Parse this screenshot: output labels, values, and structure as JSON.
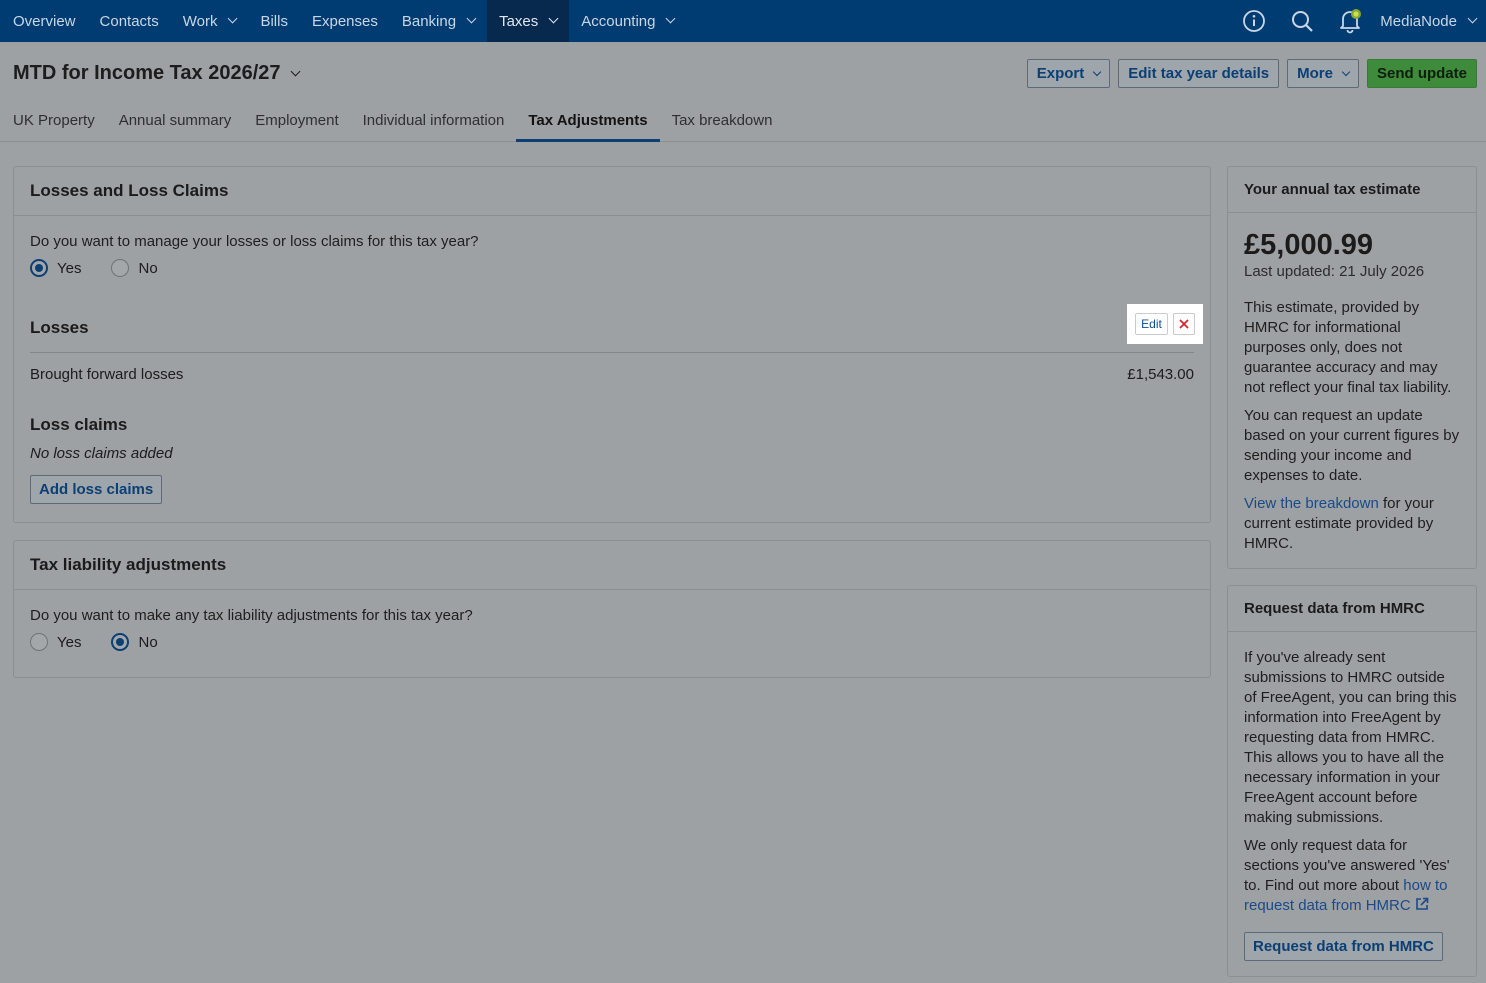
{
  "nav": {
    "items": [
      {
        "label": "Overview",
        "dropdown": false,
        "active": false
      },
      {
        "label": "Contacts",
        "dropdown": false,
        "active": false
      },
      {
        "label": "Work",
        "dropdown": true,
        "active": false
      },
      {
        "label": "Bills",
        "dropdown": false,
        "active": false
      },
      {
        "label": "Expenses",
        "dropdown": false,
        "active": false
      },
      {
        "label": "Banking",
        "dropdown": true,
        "active": false
      },
      {
        "label": "Taxes",
        "dropdown": true,
        "active": true
      },
      {
        "label": "Accounting",
        "dropdown": true,
        "active": false
      }
    ],
    "account": "MediaNode",
    "icons": [
      "info-icon",
      "search-icon",
      "bell-icon"
    ]
  },
  "header": {
    "title": "MTD for Income Tax 2026/27",
    "actions": {
      "export": "Export",
      "edit_tax_year": "Edit tax year details",
      "more": "More",
      "send_update": "Send update"
    },
    "tabs": [
      {
        "label": "UK Property",
        "active": false
      },
      {
        "label": "Annual summary",
        "active": false
      },
      {
        "label": "Employment",
        "active": false
      },
      {
        "label": "Individual information",
        "active": false
      },
      {
        "label": "Tax Adjustments",
        "active": true
      },
      {
        "label": "Tax breakdown",
        "active": false
      }
    ]
  },
  "losses_card": {
    "title": "Losses and Loss Claims",
    "question": "Do you want to manage your losses or loss claims for this tax year?",
    "yes_label": "Yes",
    "no_label": "No",
    "selected": "Yes",
    "losses_title": "Losses",
    "edit_label": "Edit",
    "row_label": "Brought forward losses",
    "row_value": "£1,543.00",
    "claims_title": "Loss claims",
    "claims_empty": "No loss claims added",
    "add_claims": "Add loss claims"
  },
  "liability_card": {
    "title": "Tax liability adjustments",
    "question": "Do you want to make any tax liability adjustments for this tax year?",
    "yes_label": "Yes",
    "no_label": "No",
    "selected": "No"
  },
  "estimate_card": {
    "title": "Your annual tax estimate",
    "amount": "£5,000.99",
    "updated": "Last updated: 21 July 2026",
    "para1": "This estimate, provided by HMRC for informational purposes only, does not guarantee accuracy and may not reflect your final tax liability.",
    "para2": "You can request an update based on your current figures by sending your income and expenses to date.",
    "link": "View the breakdown",
    "para3_rest": " for your current estimate provided by HMRC."
  },
  "hmrc_card": {
    "title": "Request data from HMRC",
    "para1": "If you've already sent submissions to HMRC outside of FreeAgent, you can bring this information into FreeAgent by requesting data from HMRC. This allows you to have all the necessary information in your FreeAgent account before making submissions.",
    "para2_start": "We only request data for sections you've answered 'Yes' to. Find out more about ",
    "link": "how to request data from HMRC",
    "button": "Request data from HMRC"
  }
}
